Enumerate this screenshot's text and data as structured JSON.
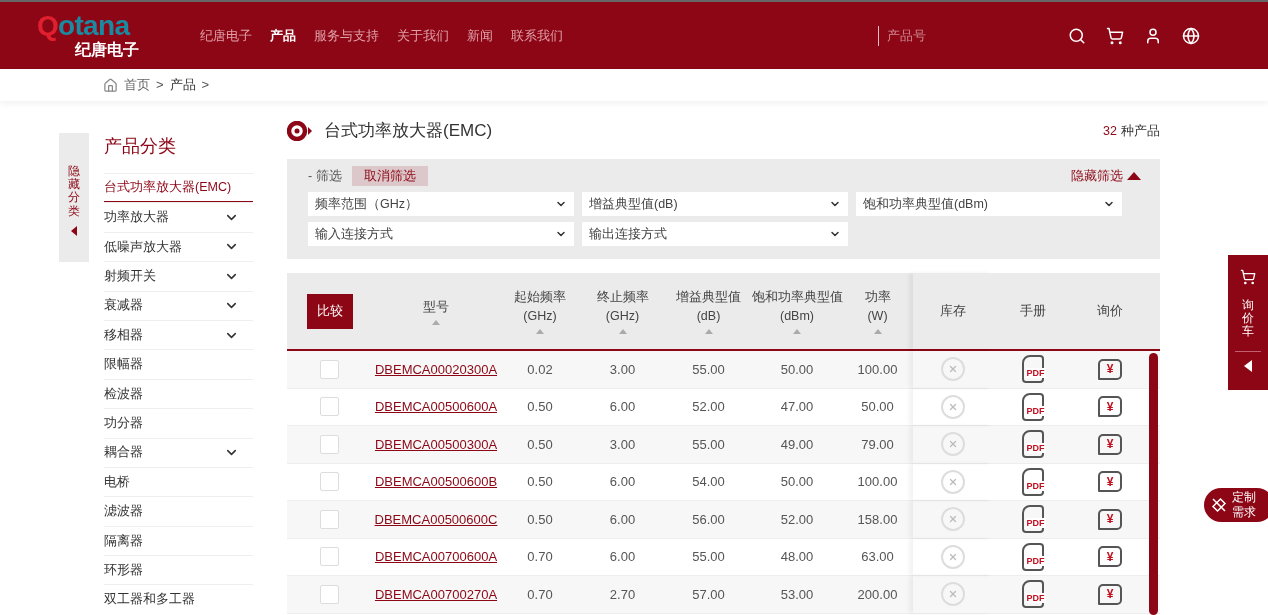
{
  "header": {
    "logo": {
      "brand": "Qotana",
      "name": "纪唐电子"
    },
    "nav": [
      {
        "label": "纪唐电子",
        "selected": false
      },
      {
        "label": "产品",
        "selected": true
      },
      {
        "label": "服务与支持",
        "selected": false
      },
      {
        "label": "关于我们",
        "selected": false
      },
      {
        "label": "新闻",
        "selected": false
      },
      {
        "label": "联系我们",
        "selected": false
      }
    ],
    "search": {
      "placeholder": "产品号"
    }
  },
  "breadcrumb": {
    "items": [
      "首页",
      "产品"
    ],
    "separator": ">"
  },
  "sidebar": {
    "toggle_label": "隐藏分类",
    "title": "产品分类",
    "items": [
      {
        "label": "台式功率放大器(EMC)",
        "selected": true,
        "expandable": false
      },
      {
        "label": "功率放大器",
        "selected": false,
        "expandable": true
      },
      {
        "label": "低噪声放大器",
        "selected": false,
        "expandable": true
      },
      {
        "label": "射频开关",
        "selected": false,
        "expandable": true
      },
      {
        "label": "衰减器",
        "selected": false,
        "expandable": true
      },
      {
        "label": "移相器",
        "selected": false,
        "expandable": true
      },
      {
        "label": "限幅器",
        "selected": false,
        "expandable": false
      },
      {
        "label": "检波器",
        "selected": false,
        "expandable": false
      },
      {
        "label": "功分器",
        "selected": false,
        "expandable": false
      },
      {
        "label": "耦合器",
        "selected": false,
        "expandable": true
      },
      {
        "label": "电桥",
        "selected": false,
        "expandable": false
      },
      {
        "label": "滤波器",
        "selected": false,
        "expandable": false
      },
      {
        "label": "隔离器",
        "selected": false,
        "expandable": false
      },
      {
        "label": "环形器",
        "selected": false,
        "expandable": false
      },
      {
        "label": "双工器和多工器",
        "selected": false,
        "expandable": false
      }
    ]
  },
  "main": {
    "title": "台式功率放大器(EMC)",
    "count": "32",
    "count_suffix": "种产品",
    "filters": {
      "label": "- 筛选",
      "clear_button": "取消筛选",
      "hide_button": "隐藏筛选",
      "selects": [
        "频率范围（GHz）",
        "增益典型值(dB)",
        "饱和功率典型值(dBm)",
        "输入连接方式",
        "输出连接方式"
      ]
    },
    "table": {
      "compare_button": "比较",
      "columns": [
        {
          "label": "型号",
          "sortable": true
        },
        {
          "label": "起始频率\n(GHz)",
          "sortable": true
        },
        {
          "label": "终止频率\n(GHz)",
          "sortable": true
        },
        {
          "label": "增益典型值\n(dB)",
          "sortable": true
        },
        {
          "label": "饱和功率典型值\n(dBm)",
          "sortable": true
        },
        {
          "label": "功率\n(W)",
          "sortable": true
        },
        {
          "label": "库存",
          "sortable": false
        },
        {
          "label": "手册",
          "sortable": false
        },
        {
          "label": "询价",
          "sortable": false
        }
      ],
      "rows": [
        {
          "checked": false,
          "model": "DBEMCA00020300A",
          "start": "0.02",
          "stop": "3.00",
          "gain": "55.00",
          "psat": "50.00",
          "power": "100.00",
          "in_stock": false,
          "manual": "PDF",
          "quote": "¥"
        },
        {
          "checked": false,
          "model": "DBEMCA00500600A",
          "start": "0.50",
          "stop": "6.00",
          "gain": "52.00",
          "psat": "47.00",
          "power": "50.00",
          "in_stock": false,
          "manual": "PDF",
          "quote": "¥"
        },
        {
          "checked": false,
          "model": "DBEMCA00500300A",
          "start": "0.50",
          "stop": "3.00",
          "gain": "55.00",
          "psat": "49.00",
          "power": "79.00",
          "in_stock": false,
          "manual": "PDF",
          "quote": "¥"
        },
        {
          "checked": false,
          "model": "DBEMCA00500600B",
          "start": "0.50",
          "stop": "6.00",
          "gain": "54.00",
          "psat": "50.00",
          "power": "100.00",
          "in_stock": false,
          "manual": "PDF",
          "quote": "¥"
        },
        {
          "checked": false,
          "model": "DBEMCA00500600C",
          "start": "0.50",
          "stop": "6.00",
          "gain": "56.00",
          "psat": "52.00",
          "power": "158.00",
          "in_stock": false,
          "manual": "PDF",
          "quote": "¥"
        },
        {
          "checked": false,
          "model": "DBEMCA00700600A",
          "start": "0.70",
          "stop": "6.00",
          "gain": "55.00",
          "psat": "48.00",
          "power": "63.00",
          "in_stock": false,
          "manual": "PDF",
          "quote": "¥"
        },
        {
          "checked": false,
          "model": "DBEMCA00700270A",
          "start": "0.70",
          "stop": "2.70",
          "gain": "57.00",
          "psat": "53.00",
          "power": "200.00",
          "in_stock": false,
          "manual": "PDF",
          "quote": "¥"
        }
      ]
    }
  },
  "floating": {
    "cart_label": "询价车",
    "custom_label": "定制需求"
  }
}
